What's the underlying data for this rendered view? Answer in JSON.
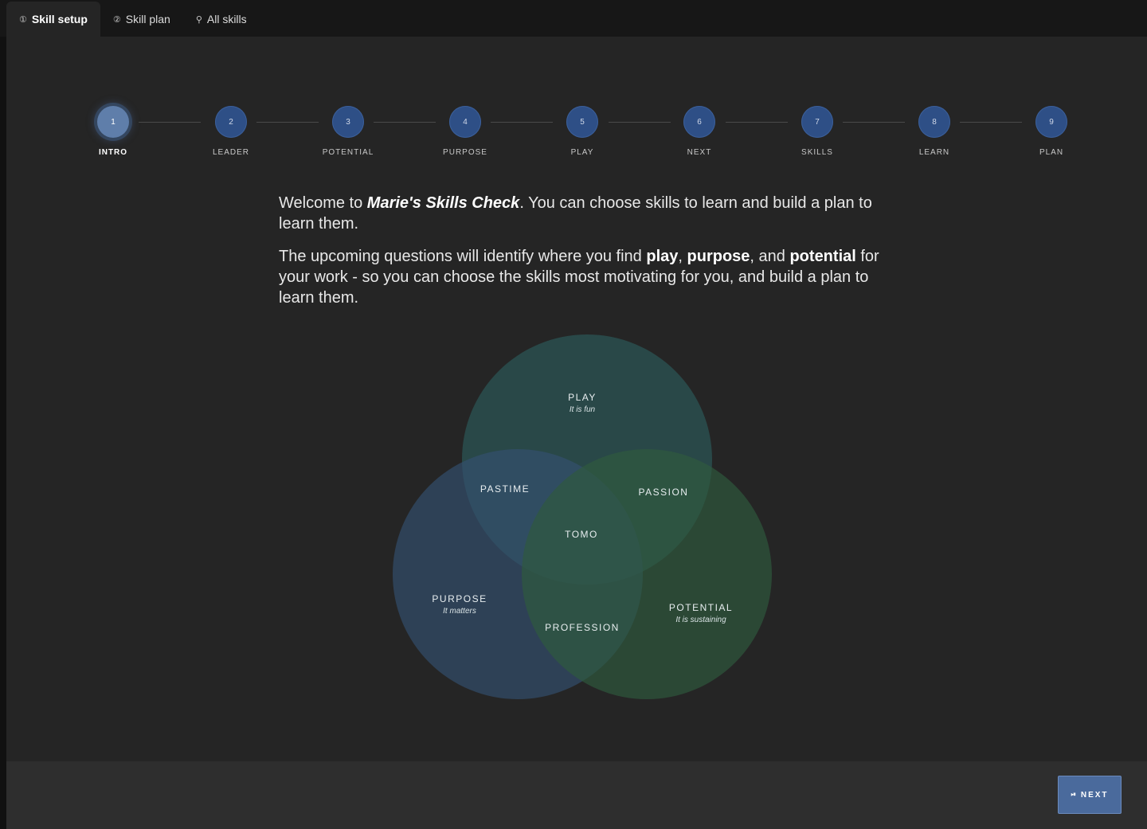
{
  "tabs": [
    {
      "icon": "①",
      "label": "Skill setup",
      "active": true
    },
    {
      "icon": "②",
      "label": "Skill plan",
      "active": false
    },
    {
      "icon": "⚲",
      "label": "All skills",
      "active": false
    }
  ],
  "steps": [
    {
      "num": "1",
      "label": "INTRO",
      "current": true
    },
    {
      "num": "2",
      "label": "LEADER"
    },
    {
      "num": "3",
      "label": "POTENTIAL"
    },
    {
      "num": "4",
      "label": "PURPOSE"
    },
    {
      "num": "5",
      "label": "PLAY"
    },
    {
      "num": "6",
      "label": "NEXT"
    },
    {
      "num": "7",
      "label": "SKILLS"
    },
    {
      "num": "8",
      "label": "LEARN"
    },
    {
      "num": "9",
      "label": "PLAN"
    }
  ],
  "intro": {
    "p1_a": "Welcome to ",
    "p1_brand": "Marie's Skills Check",
    "p1_b": ". You can choose skills to learn and build a plan to learn them.",
    "p2_a": "The upcoming questions will identify where you find ",
    "p2_play": "play",
    "p2_sep1": ", ",
    "p2_purpose": "purpose",
    "p2_sep2": ", and ",
    "p2_potential": "potential",
    "p2_b": " for your work - so you can choose the skills most motivating for you, and build a plan to learn them."
  },
  "venn": {
    "play": {
      "title": "PLAY",
      "sub": "It is fun"
    },
    "purpose": {
      "title": "PURPOSE",
      "sub": "It matters"
    },
    "potential": {
      "title": "POTENTIAL",
      "sub": "It is sustaining"
    },
    "pastime": "PASTIME",
    "passion": "PASSION",
    "tomo": "TOMO",
    "profession": "PROFESSION",
    "colors": {
      "play": "#2c5a5a",
      "purpose": "#34506e",
      "potential": "#2f5a3e"
    }
  },
  "footer": {
    "next_icon": "⏯",
    "next_label": "NEXT"
  }
}
